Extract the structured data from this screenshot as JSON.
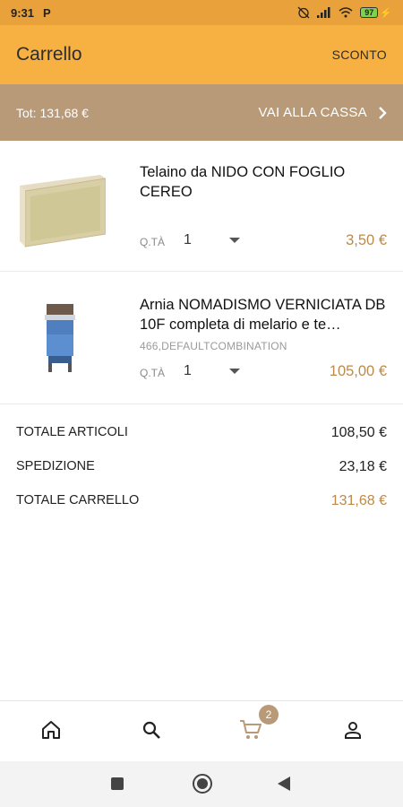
{
  "status_bar": {
    "time": "9:31",
    "notif_icon": "P",
    "battery": "97"
  },
  "app_bar": {
    "title": "Carrello",
    "action": "SCONTO"
  },
  "checkout": {
    "total": "Tot: 131,68 €",
    "button_label": "VAI ALLA CASSA"
  },
  "items": [
    {
      "name": "Telaino da NIDO CON FOGLIO CEREO",
      "ref": "",
      "qty_label": "Q.TÀ",
      "qty": "1",
      "price": "3,50 €"
    },
    {
      "name": "Arnia NOMADISMO VERNICIATA DB 10F completa di melario e te…",
      "ref": "466,DEFAULTCOMBINATION",
      "qty_label": "Q.TÀ",
      "qty": "1",
      "price": "105,00 €"
    }
  ],
  "totals": {
    "articles_label": "TOTALE ARTICOLI",
    "articles_value": "108,50 €",
    "shipping_label": "SPEDIZIONE",
    "shipping_value": "23,18 €",
    "cart_label": "TOTALE CARRELLO",
    "cart_value": "131,68 €"
  },
  "bottom_nav": {
    "cart_badge": "2",
    "icons": [
      "home-icon",
      "search-icon",
      "cart-icon",
      "account-icon"
    ]
  },
  "colors": {
    "status_bar": "#e9a23b",
    "app_bar": "#f7b143",
    "checkout_bar": "#b99a78",
    "price": "#bb8a4a",
    "badge": "#b99a78"
  }
}
